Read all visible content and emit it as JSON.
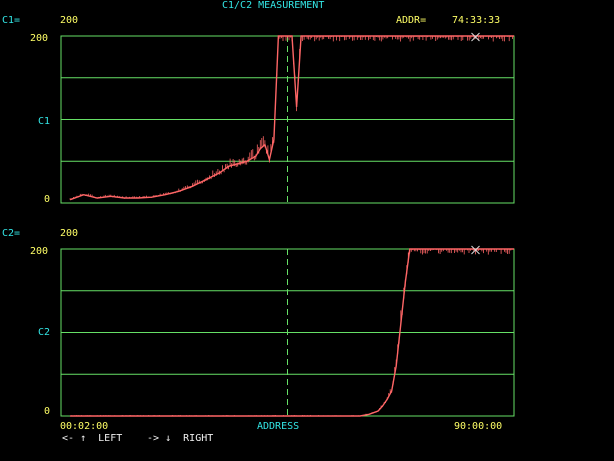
{
  "header": {
    "title": "C1/C2 MEASUREMENT"
  },
  "status": {
    "c1_label": "C1=",
    "c1_value": "200",
    "addr_label": "ADDR=",
    "addr_value": "74:33:33",
    "c2_label": "C2=",
    "c2_value": "200"
  },
  "plot1": {
    "y_top": "200",
    "y_mid": "C1",
    "y_bottom": "0"
  },
  "plot2": {
    "y_top": "200",
    "y_mid": "C2",
    "y_bottom": "0"
  },
  "x_axis": {
    "start": "00:02:00",
    "label": "ADDRESS",
    "end": "90:00:00"
  },
  "footer": {
    "left_arrow": "<-",
    "up_arrow": "↑",
    "left_label": "LEFT",
    "right_arrow": "->",
    "down_arrow": "↓",
    "right_label": "RIGHT"
  },
  "colors": {
    "grid": "#66e066",
    "trace": "#ff6666",
    "cursor": "#dddddd"
  },
  "chart_data": [
    {
      "type": "line",
      "name": "C1",
      "ylim": [
        0,
        200
      ],
      "x_start": "00:02:00",
      "x_end": "90:00:00",
      "x_fraction": [
        0.02,
        0.05,
        0.08,
        0.11,
        0.14,
        0.17,
        0.2,
        0.23,
        0.26,
        0.29,
        0.32,
        0.35,
        0.37,
        0.39,
        0.41,
        0.43,
        0.44,
        0.45,
        0.46,
        0.47,
        0.48,
        0.49,
        0.5,
        0.51,
        0.52,
        0.53,
        0.54,
        0.55,
        0.56,
        0.58,
        1.0
      ],
      "values": [
        4,
        10,
        6,
        8,
        6,
        6,
        7,
        10,
        14,
        20,
        28,
        36,
        44,
        47,
        50,
        56,
        65,
        70,
        52,
        76,
        200,
        200,
        200,
        200,
        115,
        200,
        200,
        200,
        200,
        200,
        200
      ]
    },
    {
      "type": "line",
      "name": "C2",
      "ylim": [
        0,
        200
      ],
      "x_start": "00:02:00",
      "x_end": "90:00:00",
      "x_fraction": [
        0.02,
        0.2,
        0.4,
        0.6,
        0.66,
        0.68,
        0.7,
        0.71,
        0.72,
        0.73,
        0.74,
        0.75,
        0.76,
        0.77,
        0.78,
        1.0
      ],
      "values": [
        0,
        0,
        0,
        0,
        0,
        2,
        6,
        12,
        20,
        30,
        60,
        110,
        160,
        200,
        200,
        200
      ]
    }
  ]
}
